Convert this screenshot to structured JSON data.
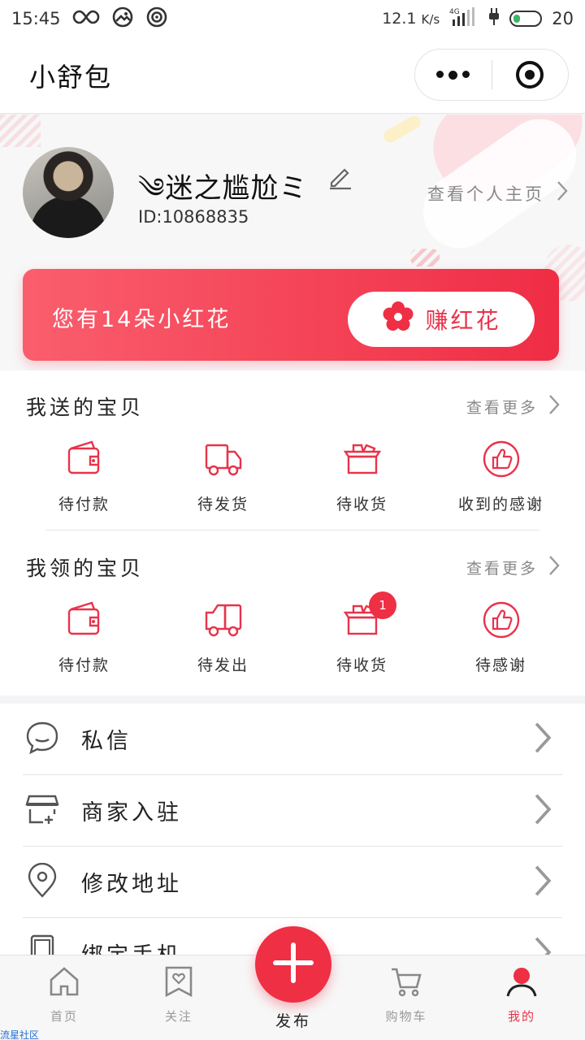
{
  "status_bar": {
    "time": "15:45",
    "speed": "12.1",
    "speed_unit": "K/s",
    "network": "4G",
    "battery": "20"
  },
  "nav": {
    "title": "小舒包"
  },
  "profile": {
    "username": "༄迷之尴尬ミ",
    "user_id": "ID:10868835",
    "homepage_link": "查看个人主页"
  },
  "banner": {
    "text": "您有14朵小红花",
    "button": "赚红花"
  },
  "given": {
    "title": "我送的宝贝",
    "more": "查看更多",
    "items": [
      {
        "label": "待付款",
        "icon": "wallet-icon"
      },
      {
        "label": "待发货",
        "icon": "truck-icon"
      },
      {
        "label": "待收货",
        "icon": "box-icon"
      },
      {
        "label": "收到的感谢",
        "icon": "thumbs-up-icon"
      }
    ]
  },
  "received": {
    "title": "我领的宝贝",
    "more": "查看更多",
    "items": [
      {
        "label": "待付款",
        "icon": "wallet-icon"
      },
      {
        "label": "待发出",
        "icon": "truck-icon"
      },
      {
        "label": "待收货",
        "icon": "box-icon",
        "badge": "1"
      },
      {
        "label": "待感谢",
        "icon": "thumbs-up-icon"
      }
    ]
  },
  "menu": [
    {
      "label": "私信",
      "icon": "chat-icon"
    },
    {
      "label": "商家入驻",
      "icon": "store-icon"
    },
    {
      "label": "修改地址",
      "icon": "location-pin-icon"
    },
    {
      "label": "绑定手机",
      "icon": "phone-icon"
    }
  ],
  "tabs": [
    {
      "label": "首页",
      "icon": "home-icon"
    },
    {
      "label": "关注",
      "icon": "bookmark-heart-icon"
    },
    {
      "label": "发布",
      "icon": "plus-icon"
    },
    {
      "label": "购物车",
      "icon": "cart-icon"
    },
    {
      "label": "我的",
      "icon": "user-icon",
      "active": true
    }
  ],
  "colors": {
    "accent": "#EE2F44",
    "banner_start": "#FA5E6D",
    "banner_end": "#EF2D45"
  },
  "watermark": "流星社区"
}
